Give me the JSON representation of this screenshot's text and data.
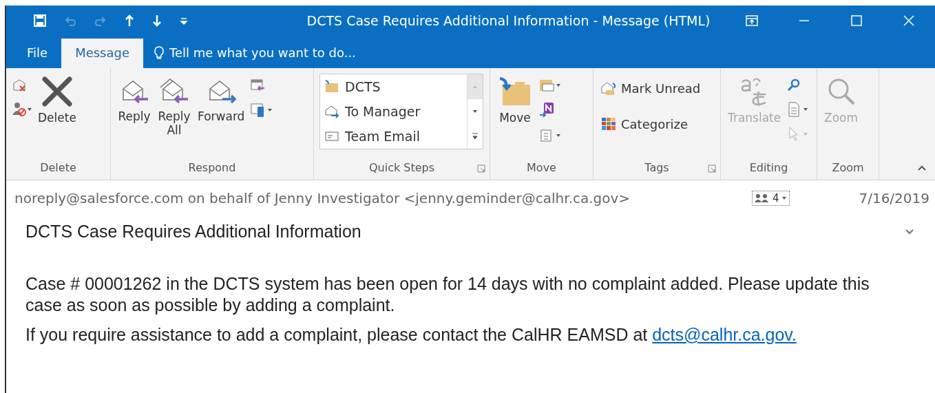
{
  "window": {
    "title": "DCTS Case Requires Additional Information - Message (HTML)"
  },
  "tabs": [
    {
      "label": "File",
      "selected": false
    },
    {
      "label": "Message",
      "selected": true
    }
  ],
  "tell_me": {
    "placeholder": "Tell me what you want to do..."
  },
  "ribbon": [
    {
      "label": "Delete",
      "launcher": false,
      "items": [
        {
          "kind": "icons"
        },
        {
          "kind": "large",
          "label": "Delete",
          "disabled": false
        }
      ]
    },
    {
      "label": "Respond",
      "launcher": false,
      "items": [
        {
          "kind": "large",
          "label": "Reply",
          "disabled": false
        },
        {
          "kind": "large",
          "label": "Reply All",
          "disabled": false
        },
        {
          "kind": "large",
          "label": "Forward",
          "disabled": false
        },
        {
          "kind": "icons"
        }
      ]
    },
    {
      "label": "Quick Steps",
      "launcher": true,
      "items": [
        {
          "kind": "gallery",
          "entries": [
            "DCTS",
            "To Manager",
            "Team Email"
          ]
        }
      ]
    },
    {
      "label": "Move",
      "launcher": false,
      "items": [
        {
          "kind": "large",
          "label": "Move",
          "disabled": false
        },
        {
          "kind": "icons"
        }
      ]
    },
    {
      "label": "Tags",
      "launcher": true,
      "items": [
        {
          "kind": "small",
          "labels": [
            "Mark Unread",
            "Categorize"
          ]
        }
      ]
    },
    {
      "label": "Editing",
      "launcher": false,
      "items": [
        {
          "kind": "large",
          "label": "Translate",
          "disabled": true
        },
        {
          "kind": "icons"
        }
      ]
    },
    {
      "label": "Zoom",
      "launcher": false,
      "items": [
        {
          "kind": "large",
          "label": "Zoom",
          "disabled": true
        }
      ]
    }
  ],
  "header": {
    "sender": "noreply@salesforce.com on behalf of Jenny Investigator <jenny.geminder@calhr.ca.gov>",
    "people_count": "4",
    "date": "7/16/2019",
    "subject": "DCTS Case Requires Additional Information"
  },
  "body": {
    "paragraphs": [
      "Case # 00001262 in the DCTS system has been open for 14 days with no complaint added. Please update this case as soon as possible by adding a complaint.",
      "If you require assistance to add a complaint, please contact the CalHR EAMSD at"
    ],
    "link": "dcts@calhr.ca.gov."
  }
}
